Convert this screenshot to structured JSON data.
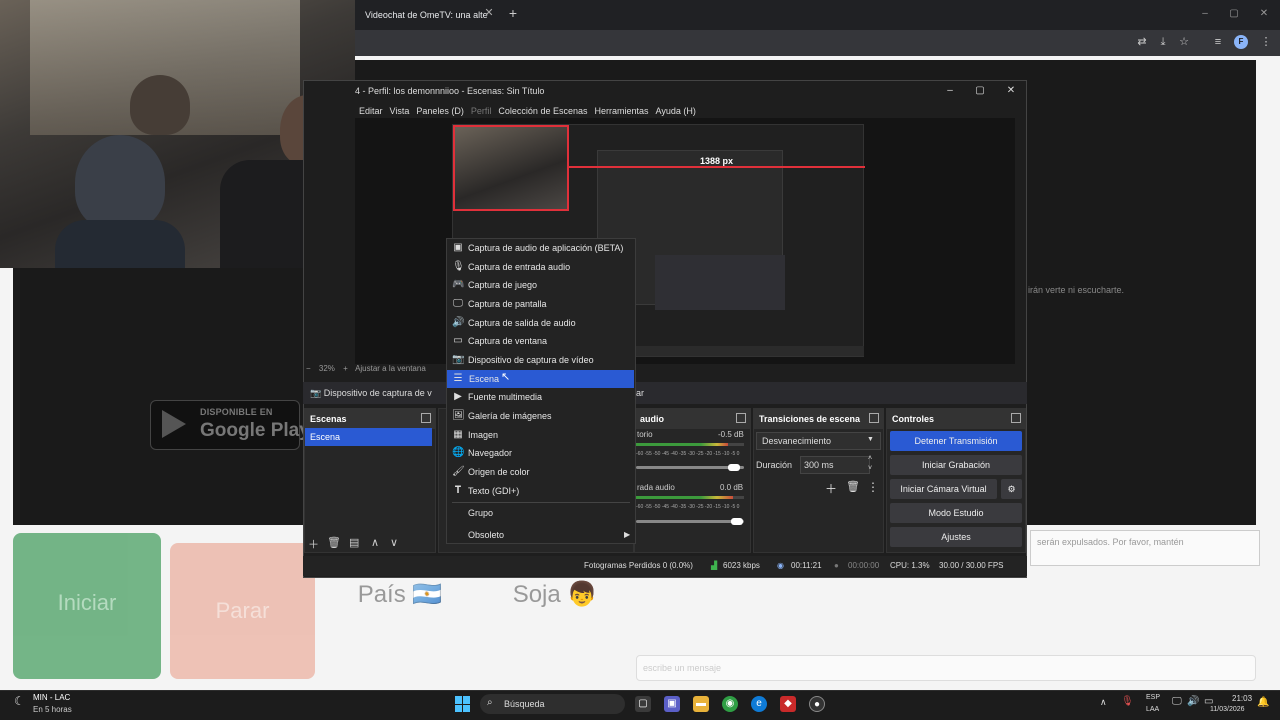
{
  "browser": {
    "tab_title": "Videochat de OmeTV: una alte",
    "tab_close": "✕",
    "new_tab": "+",
    "window_controls": [
      "–",
      "▢",
      "✕"
    ],
    "profile_initial": "F"
  },
  "page": {
    "side_text": "irán verte ni escucharte.",
    "store_badge": {
      "available": "DISPONIBLE EN",
      "name": "Google Play"
    },
    "start_button": "Iniciar",
    "stop_button": "Parar",
    "country_button": "País 🇦🇷",
    "gender_button": "Soja 👦",
    "chat_notice": "serán expulsados. Por favor, mantén",
    "chat_placeholder": "escribe un mensaje"
  },
  "obs": {
    "title": "4 - Perfil: los demonnniioo - Escenas: Sin Título",
    "menu": [
      "Editar",
      "Vista",
      "Paneles (D)",
      "Perfil",
      "Colección de Escenas",
      "Herramientas",
      "Ayuda (H)"
    ],
    "preview_px": "1388 px",
    "zoom": "32%",
    "fit_label": "Ajustar a la ventana",
    "source_label": "Dispositivo de captura de v",
    "source_tail": "ar",
    "docks": {
      "scenes": "Escenas",
      "mixer": "audio",
      "transitions": "Transiciones de escena",
      "controls": "Controles"
    },
    "scene_item": "Escena",
    "mixer": {
      "ch1_name": "torio",
      "ch1_db": "-0.5 dB",
      "ch2_name": "rada audio",
      "ch2_db": "0.0 dB",
      "ticks": "-60 -55 -50 -45 -40 -35 -30 -25 -20 -15 -10 -5 0",
      "ch1_level": 0.85,
      "ch2_level": 0.9
    },
    "transition": {
      "selected": "Desvanecimiento",
      "duration_label": "Duración",
      "duration_value": "300 ms"
    },
    "controls": [
      "Detener Transmisión",
      "Iniciar Grabación",
      "Iniciar Cámara Virtual",
      "Modo Estudio",
      "Ajustes"
    ],
    "status": {
      "dropped": "Fotogramas Perdidos 0 (0.0%)",
      "bitrate": "6023 kbps",
      "stream_time": "00:11:21",
      "rec_time": "00:00:00",
      "cpu": "CPU: 1.3%",
      "fps": "30.00 / 30.00 FPS"
    },
    "context_menu": [
      {
        "label": "Captura de audio de aplicación (BETA)",
        "icon": "app-audio-icon",
        "glyph": "▣"
      },
      {
        "label": "Captura de entrada audio",
        "icon": "mic-icon",
        "glyph": "🎙"
      },
      {
        "label": "Captura de juego",
        "icon": "gamepad-icon",
        "glyph": "🎮"
      },
      {
        "label": "Captura de pantalla",
        "icon": "monitor-icon",
        "glyph": "🖵"
      },
      {
        "label": "Captura de salida de audio",
        "icon": "speaker-icon",
        "glyph": "🔊"
      },
      {
        "label": "Captura de ventana",
        "icon": "window-icon",
        "glyph": "▭"
      },
      {
        "label": "Dispositivo de captura de vídeo",
        "icon": "camera-icon",
        "glyph": "📷"
      },
      {
        "label": "Escena",
        "icon": "list-icon",
        "glyph": "☰"
      },
      {
        "label": "Fuente multimedia",
        "icon": "play-icon",
        "glyph": "▶"
      },
      {
        "label": "Galería de imágenes",
        "icon": "gallery-icon",
        "glyph": "🖼"
      },
      {
        "label": "Imagen",
        "icon": "image-icon",
        "glyph": "▦"
      },
      {
        "label": "Navegador",
        "icon": "globe-icon",
        "glyph": "🌐"
      },
      {
        "label": "Origen de color",
        "icon": "brush-icon",
        "glyph": "🖌"
      },
      {
        "label": "Texto (GDI+)",
        "icon": "text-icon",
        "glyph": "𝐓"
      },
      {
        "label": "Grupo",
        "icon": "",
        "glyph": ""
      },
      {
        "label": "Obsoleto",
        "icon": "chevron-right-icon",
        "glyph": "▶"
      }
    ]
  },
  "taskbar": {
    "weather_title": "MIN - LAC",
    "weather_sub": "En 5 horas",
    "search": "Búsqueda",
    "lang1": "ESP",
    "lang2": "LAA",
    "time": "21:03",
    "date": "11/03/2026"
  }
}
